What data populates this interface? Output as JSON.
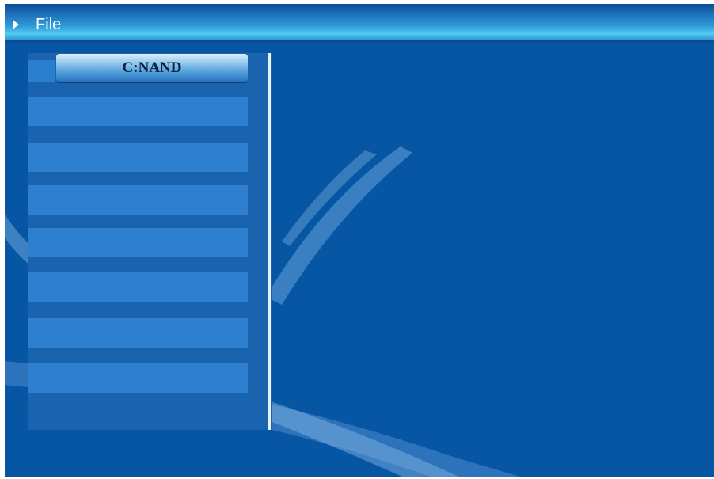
{
  "window": {
    "title": "File"
  },
  "drive": {
    "label": "C:NAND"
  },
  "file_list": {
    "items": [
      "",
      "",
      "",
      "",
      "",
      "",
      ""
    ]
  },
  "colors": {
    "background": "#0756a4",
    "title_bar_highlight": "#52c9ee",
    "panel": "#1a63ae",
    "list_row": "#2f7fd0",
    "divider": "#e8f0fa"
  },
  "icons": {
    "title": "play-arrow-icon"
  }
}
